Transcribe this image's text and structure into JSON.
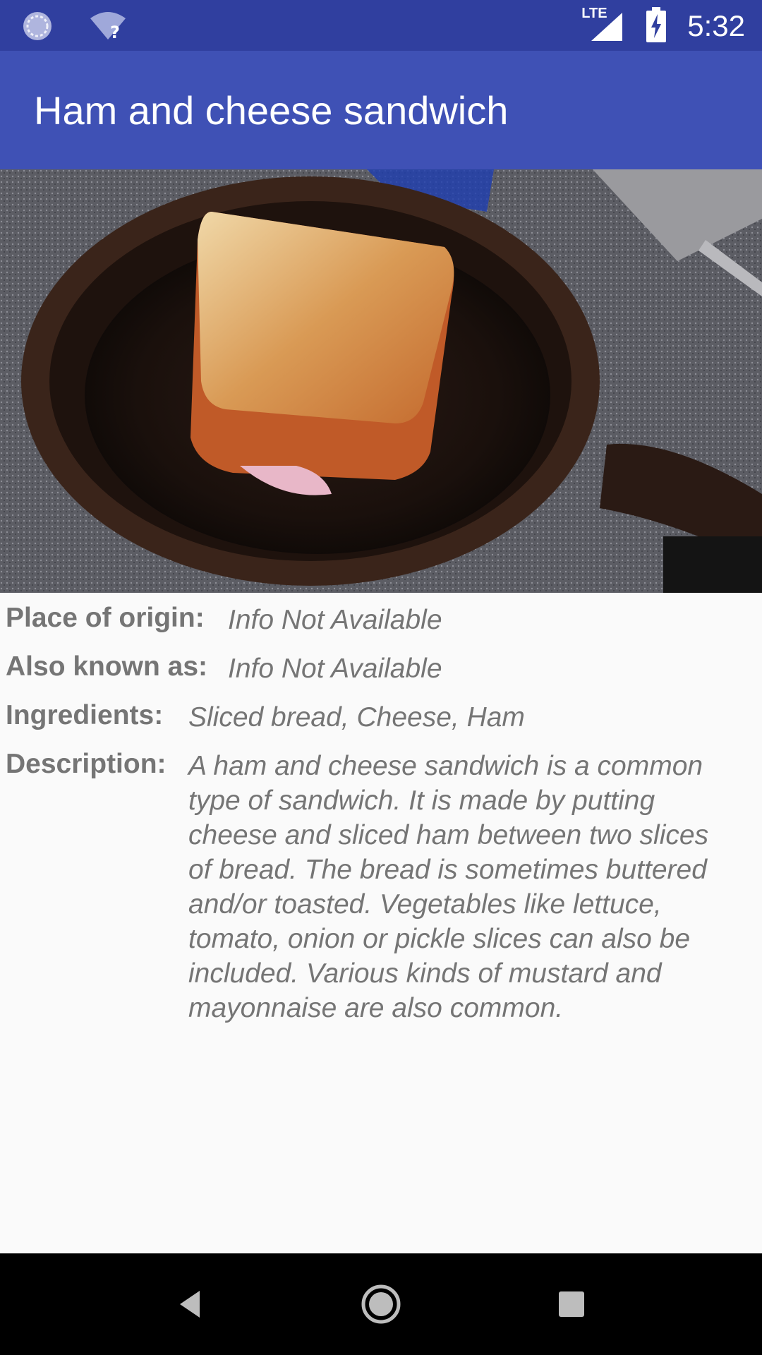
{
  "status_bar": {
    "time": "5:32",
    "network_label": "LTE",
    "icons": [
      "sync-icon",
      "wifi-unknown-icon",
      "signal-icon",
      "battery-charging-icon"
    ]
  },
  "app_bar": {
    "title": "Ham and cheese sandwich"
  },
  "image": {
    "alt": "Ham and cheese sandwich in a cast iron skillet"
  },
  "details": {
    "origin": {
      "label": "Place of origin:",
      "value": "Info Not Available"
    },
    "aka": {
      "label": "Also known as:",
      "value": "Info Not Available"
    },
    "ingredients": {
      "label": "Ingredients:",
      "value": "Sliced bread, Cheese, Ham"
    },
    "description": {
      "label": "Description:",
      "lines": [
        "A ham and cheese sandwich is a common",
        "type of sandwich. It is made by putting",
        "cheese and sliced ham between two slices",
        "of bread. The bread is sometimes buttered",
        "and/or toasted. Vegetables like lettuce,",
        "tomato, onion or pickle slices can also be",
        "included. Various kinds of mustard and",
        "mayonnaise are also common."
      ]
    }
  },
  "nav": {
    "back": "back-icon",
    "home": "home-icon",
    "recents": "recents-icon"
  },
  "colors": {
    "status_bar": "#303f9f",
    "app_bar": "#3f51b5",
    "text": "#757575",
    "background": "#fafafa"
  }
}
